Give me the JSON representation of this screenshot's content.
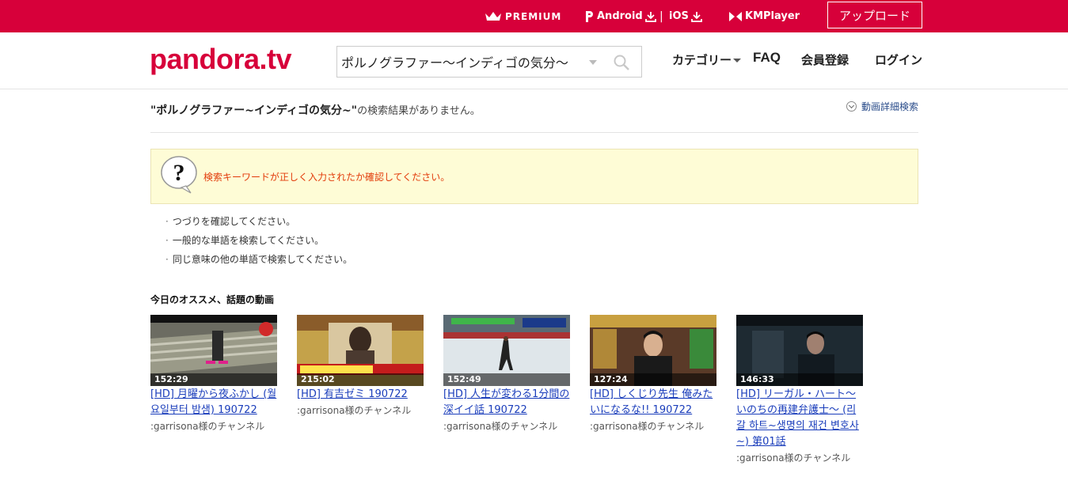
{
  "topbar": {
    "premium": "PREMIUM",
    "android": "Android",
    "separator": "|",
    "ios": "iOS",
    "kmplayer": "KMPlayer",
    "upload": "アップロード"
  },
  "header": {
    "logo": "pandora.tv",
    "search_value": "ポルノグラファー～インディゴの気分～",
    "nav": {
      "category": "カテゴリー",
      "faq": "FAQ",
      "register": "会員登録",
      "login": "ログイン"
    }
  },
  "result": {
    "query": "\"ポルノグラファー~インディゴの気分~\"",
    "suffix": "の検索結果がありません。",
    "advanced_search": "動画詳細検索"
  },
  "notice": {
    "message": "検索キーワードが正しく入力されたか確認してください。",
    "tips": [
      "つづりを確認してください。",
      "一般的な単語を検索してください。",
      "同じ意味の他の単語で検索してください。"
    ]
  },
  "recommend": {
    "title": "今日のオススメ、話題の動画",
    "videos": [
      {
        "duration": "152:29",
        "title": "[HD] 月曜から夜ふかし (월요일부터 밤샘) 190722",
        "channel": ":garrisona様のチャンネル"
      },
      {
        "duration": "215:02",
        "title": "[HD] 有吉ゼミ 190722",
        "channel": ":garrisona様のチャンネル"
      },
      {
        "duration": "152:49",
        "title": "[HD] 人生が変わる1分間の深イイ話 190722",
        "channel": ":garrisona様のチャンネル"
      },
      {
        "duration": "127:24",
        "title": "[HD] しくじり先生 俺みたいになるな!! 190722",
        "channel": ":garrisona様のチャンネル"
      },
      {
        "duration": "146:33",
        "title": "[HD] リーガル・ハート～いのちの再建弁護士～ (리갈 하트~생명의 재건 변호사~) 第01話",
        "channel": ":garrisona様のチャンネル"
      }
    ]
  },
  "colors": {
    "brand": "#d7003a",
    "link": "#1a3dbb",
    "notice_bg": "#fefcd6",
    "notice_text": "#e23b0a"
  }
}
